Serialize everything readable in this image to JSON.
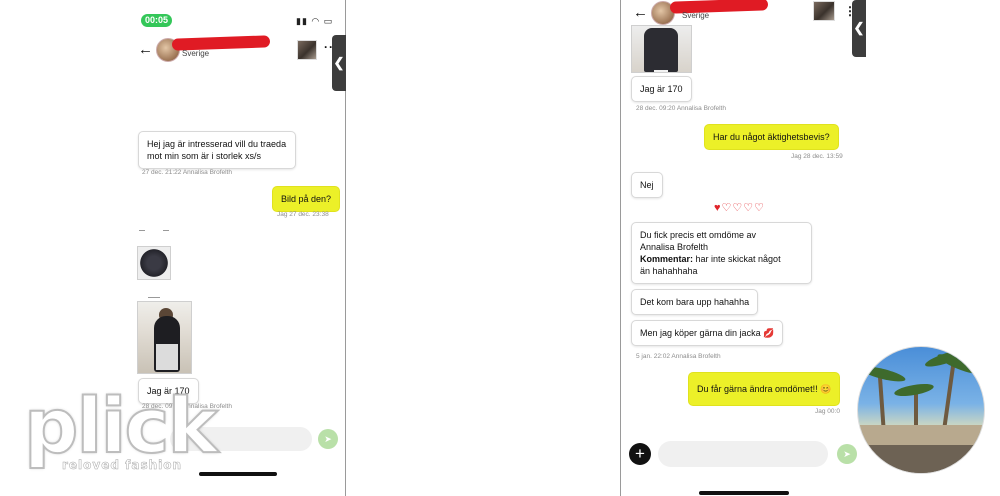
{
  "left_phone": {
    "status": {
      "time": "00:05",
      "icons": "▮▮ ◠ ▭"
    },
    "header": {
      "subtitle": "Sverige",
      "side_tab_glyph": "❮",
      "more_glyph": "···",
      "back_glyph": "←"
    },
    "messages": [
      {
        "id": "m1",
        "text": "Hej jag är intresserad vill du traeda\nmot min som är i  storlek xs/s",
        "meta": "27 dec. 21:22  Annalisa Brofelth"
      },
      {
        "id": "m2",
        "text": "Bild på den?",
        "meta": "Jag   27 dec. 23:38"
      },
      {
        "id": "m3",
        "text": "Jag är 170",
        "meta": "28 dec. 09:20  Annalisa Brofelth"
      }
    ],
    "composer": {
      "send_glyph": "➤",
      "plus_glyph": "+"
    }
  },
  "right_phone": {
    "header": {
      "subtitle": "Sverige",
      "side_tab_glyph": "❮",
      "more_glyph": "⋮",
      "back_glyph": "←"
    },
    "messages": [
      {
        "id": "r1",
        "text": "Jag är 170",
        "meta": "28 dec. 09:20  Annalisa Brofelth"
      },
      {
        "id": "r2",
        "text": "Har du något äktighetsbevis?",
        "meta": "Jag   28 dec. 13:59"
      },
      {
        "id": "r3",
        "text": "Nej"
      },
      {
        "id": "r4_line1",
        "text": "Du fick precis ett omdöme av"
      },
      {
        "id": "r4_line2",
        "text": "Annalisa Brofelth"
      },
      {
        "id": "r4_label",
        "text": "Kommentar:"
      },
      {
        "id": "r4_comment",
        "text": " har inte skickat något\nän hahahhaha"
      },
      {
        "id": "r5",
        "text": "Det kom bara upp hahahha"
      },
      {
        "id": "r6",
        "text": "Men jag köper gärna din jacka 💋",
        "meta": "5 jan. 22:02  Annalisa Brofelth"
      },
      {
        "id": "r7",
        "text": "Du får gärna ändra omdömet!! 😊",
        "meta": "Jag   00:0"
      }
    ],
    "rating": {
      "filled": 1,
      "total": 5,
      "filled_glyph": "♥",
      "empty_glyph": "♡"
    },
    "composer": {
      "plus_glyph": "+",
      "send_glyph": "➤"
    }
  },
  "watermark": {
    "logo": "plick",
    "tagline": "reloved fashion"
  },
  "colors": {
    "my_bubble": "#ecf028",
    "status_pill": "#34c759",
    "redaction": "#e01b24",
    "heart": "#e0242b",
    "send_button": "#b9e0a8"
  }
}
